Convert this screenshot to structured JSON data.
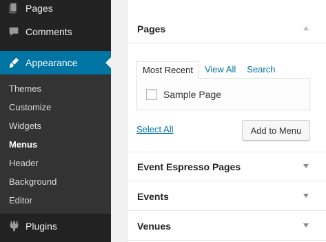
{
  "sidebar": {
    "pages_label": "Pages",
    "comments_label": "Comments",
    "appearance_label": "Appearance",
    "plugins_label": "Plugins",
    "submenu": [
      {
        "label": "Themes"
      },
      {
        "label": "Customize"
      },
      {
        "label": "Widgets"
      },
      {
        "label": "Menus",
        "current": true
      },
      {
        "label": "Header"
      },
      {
        "label": "Background"
      },
      {
        "label": "Editor"
      }
    ]
  },
  "main": {
    "pages_section": {
      "title": "Pages",
      "tabs": [
        {
          "label": "Most Recent",
          "active": true
        },
        {
          "label": "View All"
        },
        {
          "label": "Search"
        }
      ],
      "items": [
        {
          "label": "Sample Page",
          "checked": false
        }
      ],
      "select_all": "Select All",
      "add_button": "Add to Menu"
    },
    "sections": [
      {
        "title": "Event Espresso Pages"
      },
      {
        "title": "Events"
      },
      {
        "title": "Venues"
      }
    ]
  },
  "colors": {
    "sidebar_bg": "#222222",
    "submenu_bg": "#333333",
    "accent": "#0074a2"
  }
}
